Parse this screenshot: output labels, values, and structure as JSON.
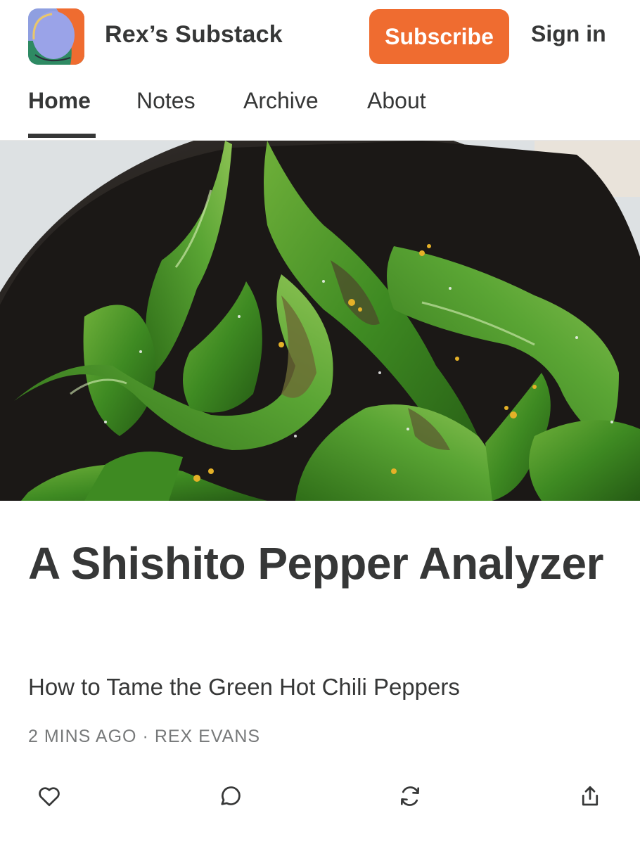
{
  "header": {
    "site_title": "Rex’s Substack",
    "subscribe_label": "Subscribe",
    "signin_label": "Sign in",
    "logo_icon": "publication-logo-icon"
  },
  "nav": {
    "tabs": [
      {
        "label": "Home",
        "active": true
      },
      {
        "label": "Notes",
        "active": false
      },
      {
        "label": "Archive",
        "active": false
      },
      {
        "label": "About",
        "active": false
      }
    ]
  },
  "hero": {
    "image_icon": "shishito-peppers-photo"
  },
  "post": {
    "title": "A Shishito Pepper Analyzer",
    "subtitle": "How to Tame the Green Hot Chili Peppers",
    "time": "2 MINS AGO",
    "separator": "·",
    "author": "REX EVANS"
  },
  "actions": [
    {
      "icon": "heart-icon"
    },
    {
      "icon": "comment-icon"
    },
    {
      "icon": "restack-icon"
    },
    {
      "icon": "share-icon"
    }
  ],
  "colors": {
    "accent": "#ef6c30",
    "text": "#363737",
    "meta": "#77797a"
  }
}
